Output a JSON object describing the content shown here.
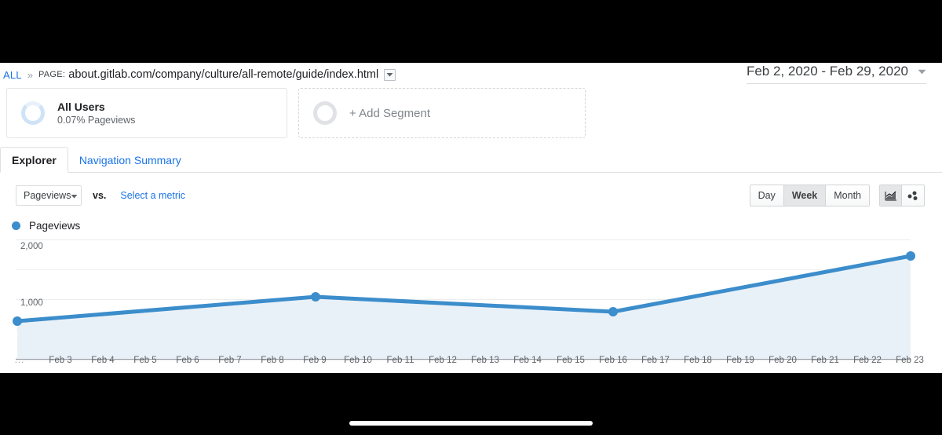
{
  "chrome": {
    "home_indicator": "home-indicator"
  },
  "breadcrumb": {
    "all_label": "ALL",
    "separator": "»",
    "key_label": "PAGE:",
    "value": "about.gitlab.com/company/culture/all-remote/guide/index.html",
    "caret_icon": "chevron-down-icon"
  },
  "date_range": {
    "label": "Feb 2, 2020 - Feb 29, 2020",
    "caret_icon": "chevron-down-icon"
  },
  "segments": [
    {
      "title": "All Users",
      "subtitle": "0.07% Pageviews",
      "icon": "donut-icon"
    },
    {
      "title": "+ Add Segment",
      "icon": "donut-outline-icon"
    }
  ],
  "tabs": [
    {
      "label": "Explorer",
      "active": true
    },
    {
      "label": "Navigation Summary",
      "active": false
    }
  ],
  "metric_bar": {
    "metric_select_value": "Pageviews",
    "metric_select_caret": "chevron-down-icon",
    "vs_label": "vs.",
    "select_metric_link": "Select a metric",
    "granularity": [
      {
        "label": "Day",
        "active": false
      },
      {
        "label": "Week",
        "active": true
      },
      {
        "label": "Month",
        "active": false
      }
    ],
    "chart_types": [
      {
        "icon": "line-chart-icon",
        "active": true
      },
      {
        "icon": "scatter-plot-icon",
        "active": false
      }
    ]
  },
  "legend": {
    "label": "Pageviews",
    "color": "#3c8dcb"
  },
  "chart_data": {
    "type": "line",
    "title": "Pageviews",
    "xlabel": "",
    "ylabel": "",
    "grid": true,
    "legend_position": "top-left",
    "series": [
      {
        "name": "Pageviews",
        "color": "#3c8dcb",
        "fill": "#e8f1f8",
        "points": [
          {
            "x": "Feb 2",
            "y": 530
          },
          {
            "x": "Feb 9",
            "y": 980
          },
          {
            "x": "Feb 16",
            "y": 720
          },
          {
            "x": "Feb 23",
            "y": 1700
          }
        ]
      }
    ],
    "ylim": [
      0,
      2200
    ],
    "yticks": [
      1000,
      2000
    ],
    "ytick_labels": [
      "1,000",
      "2,000"
    ],
    "x_tick_labels": [
      "...",
      "Feb 3",
      "Feb 4",
      "Feb 5",
      "Feb 6",
      "Feb 7",
      "Feb 8",
      "Feb 9",
      "Feb 10",
      "Feb 11",
      "Feb 12",
      "Feb 13",
      "Feb 14",
      "Feb 15",
      "Feb 16",
      "Feb 17",
      "Feb 18",
      "Feb 19",
      "Feb 20",
      "Feb 21",
      "Feb 22",
      "Feb 23"
    ]
  }
}
